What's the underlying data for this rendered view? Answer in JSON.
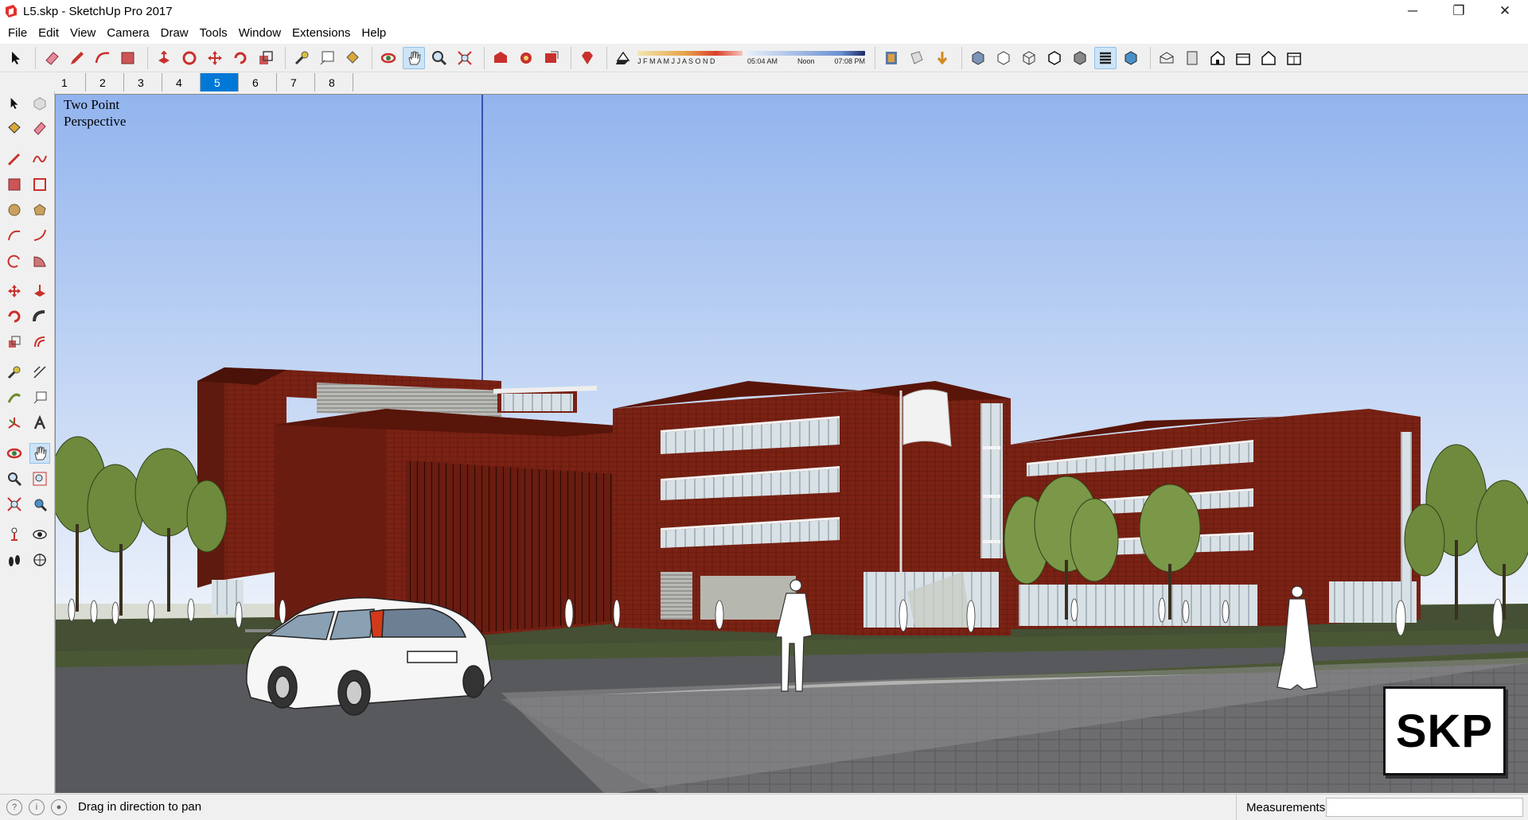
{
  "window": {
    "title": "L5.skp - SketchUp Pro 2017",
    "controls": [
      "─",
      "❐",
      "✕"
    ]
  },
  "menu": [
    "File",
    "Edit",
    "View",
    "Camera",
    "Draw",
    "Tools",
    "Window",
    "Extensions",
    "Help"
  ],
  "shadows": {
    "months": "J F M A M J J A S O N D",
    "time_start": "05:04 AM",
    "time_mid": "Noon",
    "time_end": "07:08 PM"
  },
  "scenes": {
    "tabs": [
      "1",
      "2",
      "3",
      "4",
      "5",
      "6",
      "7",
      "8"
    ],
    "active": "5"
  },
  "viewport": {
    "camera_label_line1": "Two Point",
    "camera_label_line2": "Perspective",
    "badge": "SKP"
  },
  "status": {
    "hint": "Drag in direction to pan",
    "measurements_label": "Measurements",
    "measurements_value": ""
  },
  "colors": {
    "brick": "#7a2214",
    "sky_top": "#93b6ee",
    "sky_bottom": "#e0ebfa",
    "grass": "#3e4a30",
    "road": "#5a5a5e",
    "selection_blue": "#0078d7"
  }
}
